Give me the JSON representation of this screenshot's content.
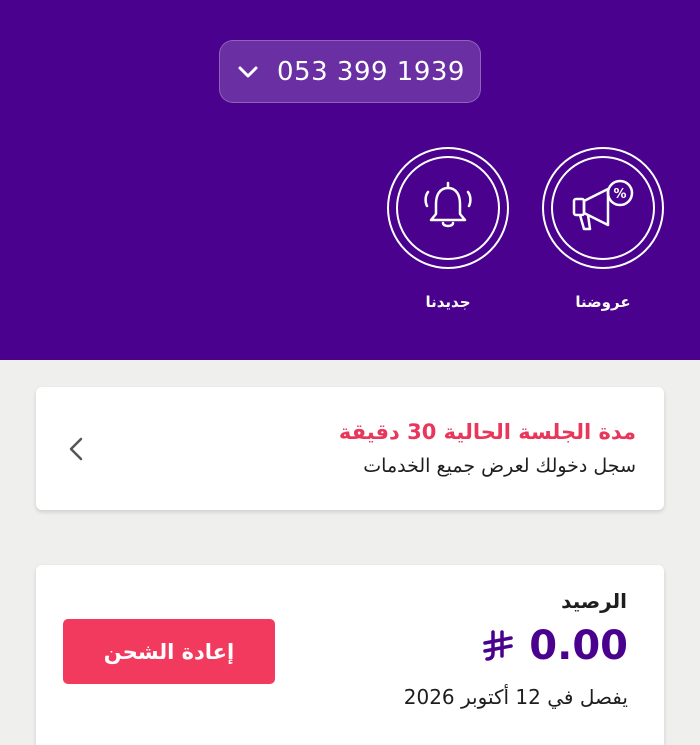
{
  "header": {
    "phone_number": "053 399 1939"
  },
  "quick_actions": [
    {
      "label": "عروضنا",
      "icon": "megaphone-percent-icon"
    },
    {
      "label": "جديدنا",
      "icon": "bell-icon"
    }
  ],
  "session_card": {
    "title": "مدة الجلسة الحالية 30 دقيقة",
    "subtitle": "سجل دخولك لعرض جميع الخدمات"
  },
  "balance_card": {
    "label": "الرصيد",
    "amount": "0.00",
    "expiry": "يفصل في 12 أكتوبر 2026",
    "recharge_label": "إعادة الشحن"
  },
  "colors": {
    "brand_purple": "#4a028e",
    "accent_pink": "#f23a5e",
    "session_title_pink": "#e8375a",
    "background": "#efefed"
  }
}
